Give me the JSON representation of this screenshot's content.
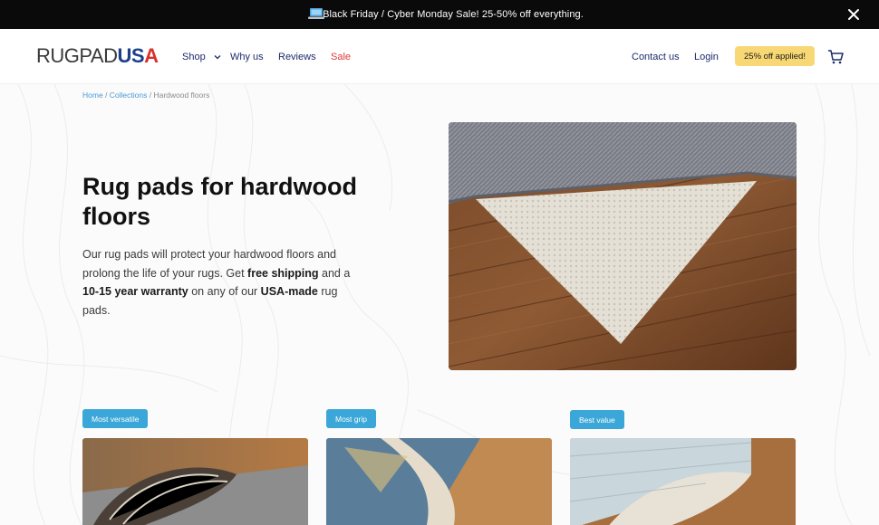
{
  "announcement": {
    "icon": "laptop-icon",
    "text": "Black Friday / Cyber Monday Sale! 25-50% off everything."
  },
  "header": {
    "logo": {
      "part1": "RUGPAD",
      "part2": "US",
      "part3": "A"
    },
    "nav": [
      {
        "label": "Shop",
        "has_dropdown": true
      },
      {
        "label": "Why us"
      },
      {
        "label": "Reviews"
      },
      {
        "label": "Sale",
        "color": "#e03a3a"
      }
    ],
    "contact_label": "Contact us",
    "login_label": "Login",
    "promo_badge": "25% off applied!",
    "cart_icon": "cart-icon"
  },
  "breadcrumb": {
    "home": "Home",
    "sep1": " / ",
    "collections": "Collections",
    "sep2": " / ",
    "current": "Hardwood floors"
  },
  "hero": {
    "title": "Rug pads for hardwood floors",
    "para": {
      "t1": "Our rug pads will protect your hardwood floors and prolong the life of your rugs. Get ",
      "b1": "free shipping",
      "t2": " and a ",
      "b2": "10-15 year warranty",
      "t3": " on any of our ",
      "b3": "USA-made",
      "t4": " rug pads."
    }
  },
  "products": [
    {
      "badge": "Most versatile"
    },
    {
      "badge": "Most grip"
    },
    {
      "badge": "Best value"
    }
  ],
  "colors": {
    "announcement_bg": "#0a0a0a",
    "nav_text": "#1d2b6b",
    "sale": "#e03a3a",
    "promo_bg": "#f7d874",
    "badge_bg": "#3aa7d8",
    "link": "#4a9ad6"
  }
}
